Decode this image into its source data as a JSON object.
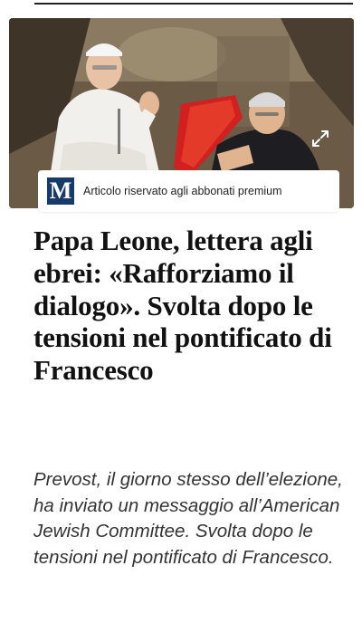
{
  "premium": {
    "label": "Articolo riservato agli abbonati premium",
    "logo_letter": "M"
  },
  "article": {
    "headline": "Papa Leone, lettera agli ebrei: «Rafforziamo il dialogo». Svolta dopo le tensioni nel pontificato di Francesco",
    "subheadline": "Prevost, il giorno stesso dell’elezione, ha inviato un messaggio all’American Jewish Committee. Svolta dopo le tensioni nel pontificato di Francesco."
  },
  "icons": {
    "expand": "expand-icon"
  },
  "colors": {
    "logo_bg": "#173a6b",
    "headline": "#111111",
    "subheadline": "#333333"
  }
}
